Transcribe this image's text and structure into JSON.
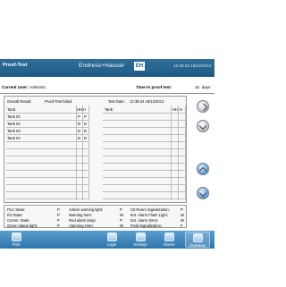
{
  "header": {
    "title": "Proof-Test",
    "brand": "Endress+Hauser",
    "brand_mark": "EH",
    "clock": "12:39:26 18/12/2012"
  },
  "user_bar": {
    "user_label": "Current User:",
    "user_value": "Admin01",
    "time_label": "Time to proof test:",
    "time_value": "10",
    "time_unit": "days"
  },
  "results": {
    "overall_label": "Overall Result:",
    "overall_value": "Proof-Test failed",
    "test_date_label": "Test Date:",
    "test_date_value": "12:38:34 18/12/2012",
    "left": {
      "header_tank": "Tank:",
      "header_hh": "HH",
      "header_h": "H",
      "rows": [
        {
          "tank": "Tank 01",
          "hh": "P",
          "h": "P"
        },
        {
          "tank": "Tank 02",
          "hh": "D",
          "h": "D"
        },
        {
          "tank": "Tank 03",
          "hh": "D",
          "h": "D"
        },
        {
          "tank": "Tank 04",
          "hh": "D",
          "h": "D"
        }
      ]
    },
    "right": {
      "header_tank": "Tank:",
      "header_hh": "HH",
      "header_h": "H"
    }
  },
  "status": {
    "col1": [
      {
        "label": "PLC State:",
        "value": "P"
      },
      {
        "label": "I/O State:",
        "value": "P"
      },
      {
        "label": "Comm. State:",
        "value": "P"
      },
      {
        "label": "Green status light:",
        "value": "P"
      }
    ],
    "col2": [
      {
        "label": "Amber warning light:",
        "value": "P"
      },
      {
        "label": "Warning horn:",
        "value": "W"
      },
      {
        "label": "Red alarm lamp:",
        "value": "P"
      },
      {
        "label": "Alarming Horn:",
        "value": "W"
      }
    ],
    "col3": [
      {
        "label": "Ctr.Room Signalization:",
        "value": "P"
      },
      {
        "label": "Ext. Alarm Flash Light:",
        "value": "W"
      },
      {
        "label": "Ext. Alarm Siren:",
        "value": "W"
      },
      {
        "label": "Field Signalization:",
        "value": "F"
      }
    ]
  },
  "footer": {
    "buttons": [
      {
        "label": "Print",
        "icon": "print-icon"
      },
      {
        "label": "Login",
        "icon": "login-icon"
      },
      {
        "label": "Settings",
        "icon": "settings-icon"
      },
      {
        "label": "Alarms",
        "icon": "alarm-icon"
      },
      {
        "label": "Overview",
        "icon": "overview-icon"
      }
    ]
  },
  "colors": {
    "header_blue": "#1f5a84",
    "footer_blue": "#2f75aa",
    "panel_border": "#9a9a9a"
  }
}
